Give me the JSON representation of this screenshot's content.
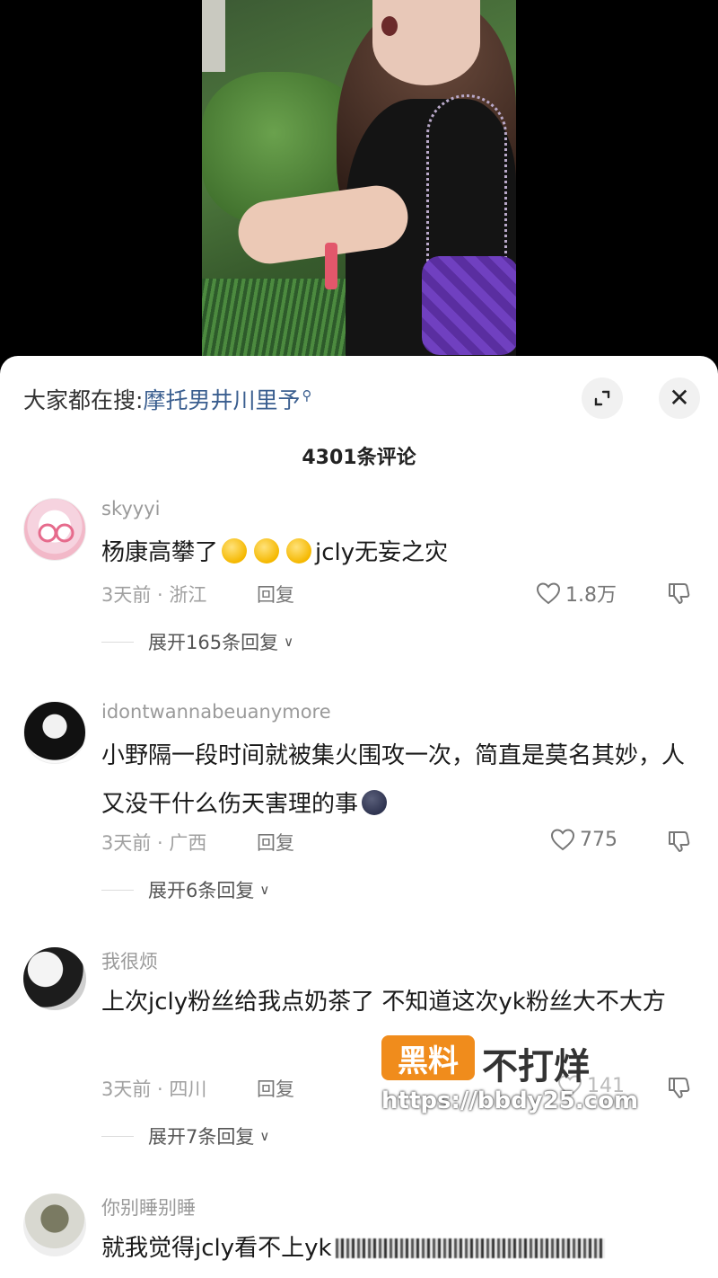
{
  "search": {
    "prefix": "大家都在搜:",
    "term": "摩托男井川里予",
    "search_icon": "search-icon"
  },
  "header": {
    "count": "4301条评论",
    "expand_icon": "expand-icon",
    "close_icon": "✕"
  },
  "comments": [
    {
      "username": "skyyyi",
      "text_before": "杨康高攀了",
      "emojis": 3,
      "text_after": "jcly无妄之灾",
      "time_location": "3天前 · 浙江",
      "reply": "回复",
      "likes": "1.8万",
      "thread": "展开165条回复"
    },
    {
      "username": "idontwannabeuanymore",
      "text": "小野隔一段时间就被集火围攻一次，简直是莫名其妙，人又没干什么伤天害理的事",
      "emojis": 1,
      "time_location": "3天前 · 广西",
      "reply": "回复",
      "likes": "775",
      "thread": "展开6条回复"
    },
    {
      "username": "我很烦",
      "text": "上次jcly粉丝给我点奶茶了 不知道这次yk粉丝大不大方",
      "time_location": "3天前 · 四川",
      "reply": "回复",
      "likes": "141",
      "thread": "展开7条回复"
    },
    {
      "username": "你别睡别睡",
      "text": "就我觉得jcly看不上yk"
    }
  ],
  "watermark": {
    "badge": "黑料",
    "rest": "不打烊",
    "url": "https://bbdy25.com"
  },
  "colors": {
    "link": "#3a5e8f",
    "watermark_orange": "#f08c1c",
    "meta_gray": "#a0a0a0"
  }
}
